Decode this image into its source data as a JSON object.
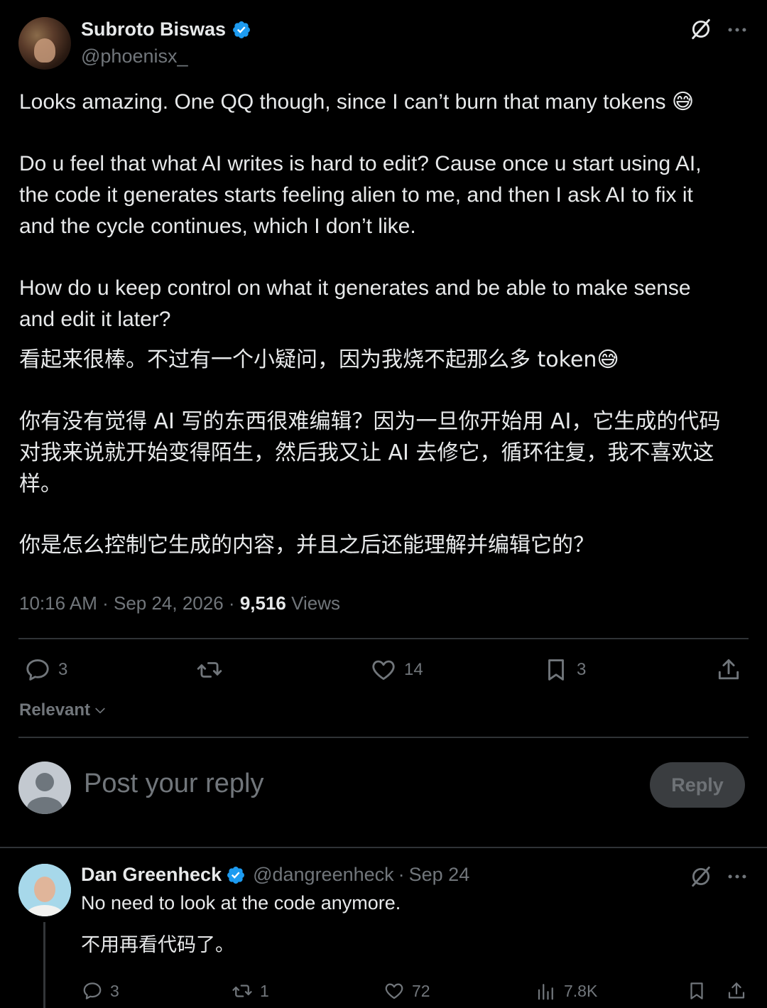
{
  "post": {
    "author_name": "Subroto Biswas",
    "author_handle": "@phoenisx_",
    "text_en_1": "Looks amazing. One QQ though, since I can’t burn that many tokens 😅",
    "text_en_2": "Do u feel that what AI writes is hard to edit? Cause once u start using AI,\nthe code it generates starts feeling alien to me, and then I ask AI to fix it\nand the cycle continues, which I don’t like.",
    "text_en_3": "How do u keep control on what it generates and be able to make sense\nand edit it later?",
    "text_cn_1": "看起来很棒。不过有一个小疑问，因为我烧不起那么多 token😅",
    "text_cn_2": "你有没有觉得 AI 写的东西很难编辑？因为一旦你开始用 AI，它生成的代码\n对我来说就开始变得陌生，然后我又让 AI 去修它，循环往复，我不喜欢这\n样。",
    "text_cn_3": "你是怎么控制它生成的内容，并且之后还能理解并编辑它的？",
    "time": "10:16 AM",
    "date": "Sep 24, 2026",
    "views_count": "9,516",
    "views_label": "Views",
    "replies": "3",
    "likes": "14",
    "bookmarks": "3"
  },
  "sort": {
    "label": "Relevant"
  },
  "composer": {
    "placeholder": "Post your reply",
    "reply_label": "Reply"
  },
  "reply": {
    "author_name": "Dan Greenheck",
    "author_handle": "@dangreenheck",
    "date": "Sep 24",
    "text_en": "No need to look at the code anymore.",
    "text_cn": "不用再看代码了。",
    "replies": "3",
    "reposts": "1",
    "likes": "72",
    "views": "7.8K"
  },
  "colors": {
    "background": "#000000",
    "text": "#e7e9ea",
    "muted": "#71767b",
    "verified": "#1d9bf0",
    "divider": "#2f3336"
  }
}
